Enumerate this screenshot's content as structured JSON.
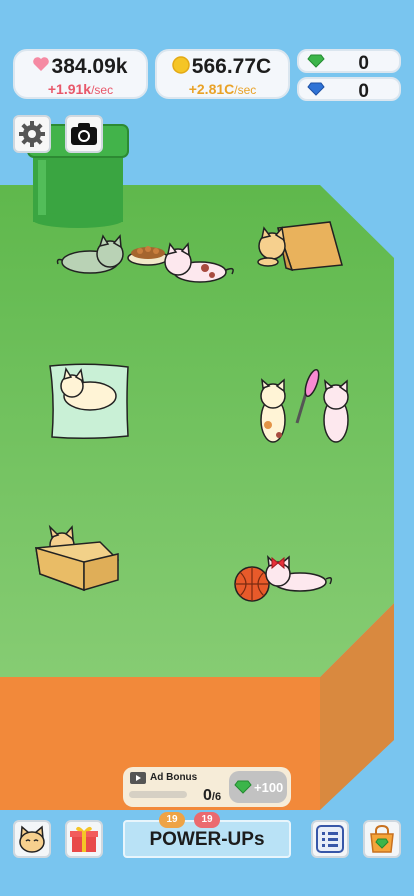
{
  "stats": {
    "hearts": {
      "value": "384.09k",
      "rate": "+1.91k",
      "unit": "/sec",
      "color": "#e8586a"
    },
    "coins": {
      "value": "566.77C",
      "rate": "+2.81C",
      "unit": "/sec",
      "color": "#e9a227"
    },
    "green_gems": {
      "value": "0"
    },
    "blue_gems": {
      "value": "0"
    }
  },
  "ad_bonus": {
    "label": "Ad Bonus",
    "progress": "0",
    "total": "/6",
    "reward": "+100"
  },
  "powerups": {
    "label": "POWER-UPs",
    "badge_left": "19",
    "badge_right": "19"
  },
  "icons": [
    "settings-gear-icon",
    "camera-icon",
    "cat-face-icon",
    "gift-box-icon",
    "list-icon",
    "shop-bag-icon",
    "heart-icon",
    "coin-icon",
    "green-gem-icon",
    "blue-gem-icon",
    "video-icon"
  ],
  "colors": {
    "sky": "#79c5ef",
    "grass": "#6cc15c",
    "dirt": "#f08a35"
  }
}
